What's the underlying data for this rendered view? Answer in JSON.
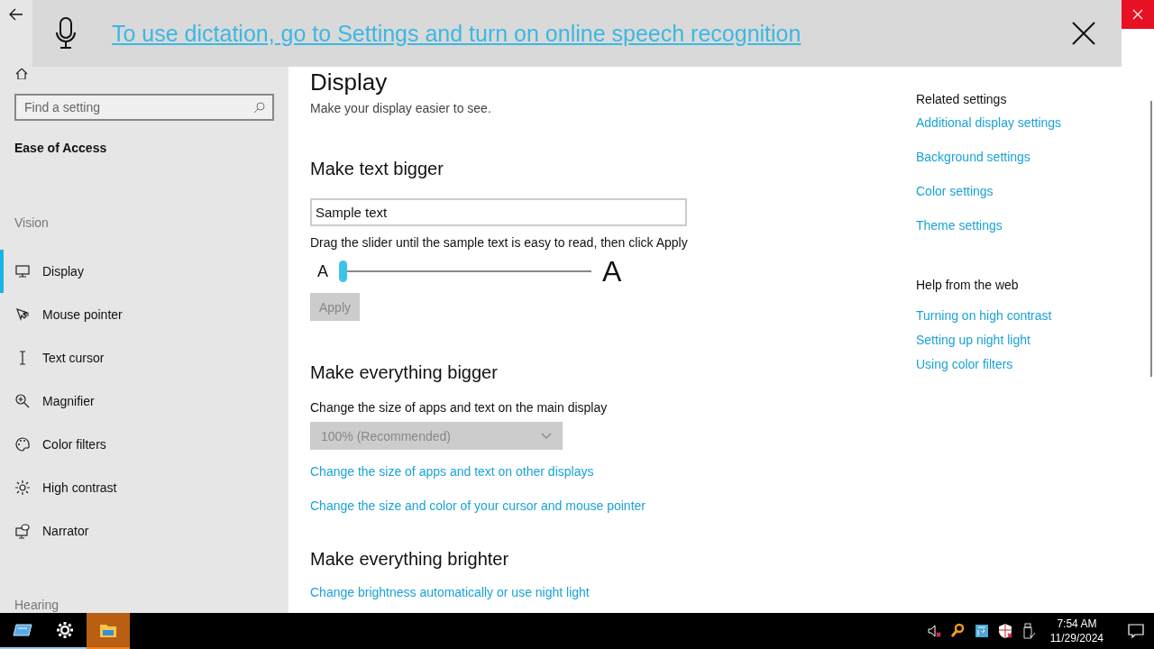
{
  "dictation_banner": {
    "message": "To use dictation, go to Settings and turn on online speech recognition"
  },
  "sidebar": {
    "search": {
      "placeholder": "Find a setting"
    },
    "category": "Ease of Access",
    "sections": [
      {
        "heading": "Vision",
        "items": [
          {
            "label": "Display",
            "kind": "monitor",
            "selected": true
          },
          {
            "label": "Mouse pointer",
            "kind": "pointer",
            "selected": false
          },
          {
            "label": "Text cursor",
            "kind": "cursor",
            "selected": false
          },
          {
            "label": "Magnifier",
            "kind": "magnifier",
            "selected": false
          },
          {
            "label": "Color filters",
            "kind": "palette",
            "selected": false
          },
          {
            "label": "High contrast",
            "kind": "sun",
            "selected": false
          },
          {
            "label": "Narrator",
            "kind": "narrator",
            "selected": false
          }
        ]
      },
      {
        "heading": "Hearing"
      }
    ]
  },
  "page": {
    "title": "Display",
    "subtitle": "Make your display easier to see.",
    "text_bigger": {
      "heading": "Make text bigger",
      "sample": {
        "value": "Sample text"
      },
      "hint": "Drag the slider until the sample text is easy to read, then click Apply",
      "slider": {
        "small_label": "A",
        "large_label": "A",
        "level": 0
      },
      "apply": {
        "label": "Apply",
        "disabled": true
      }
    },
    "everything_bigger": {
      "heading": "Make everything bigger",
      "label": "Change the size of apps and text on the main display",
      "dropdown": {
        "value": "100% (Recommended)",
        "disabled": true
      },
      "links": [
        "Change the size of apps and text on other displays",
        "Change the size and color of your cursor and mouse pointer"
      ]
    },
    "everything_brighter": {
      "heading": "Make everything brighter",
      "links": [
        "Change brightness automatically or use night light"
      ]
    }
  },
  "related": [
    {
      "heading": "Related settings",
      "links": [
        "Additional display settings",
        "Background settings",
        "Color settings",
        "Theme settings"
      ]
    },
    {
      "heading": "Help from the web",
      "links": [
        "Turning on high contrast",
        "Setting up night light",
        "Using color filters"
      ]
    }
  ],
  "taskbar": {
    "apps": [
      {
        "kind": "tablet",
        "running": true,
        "selected": false
      },
      {
        "kind": "settings",
        "running": true,
        "selected": false
      },
      {
        "kind": "explorer",
        "running": true,
        "selected": true
      }
    ],
    "tray": [
      {
        "kind": "volume"
      },
      {
        "kind": "search"
      },
      {
        "kind": "app"
      },
      {
        "kind": "shield"
      },
      {
        "kind": "usb"
      }
    ],
    "time": "7:54 AM",
    "date": "11/29/2024"
  }
}
